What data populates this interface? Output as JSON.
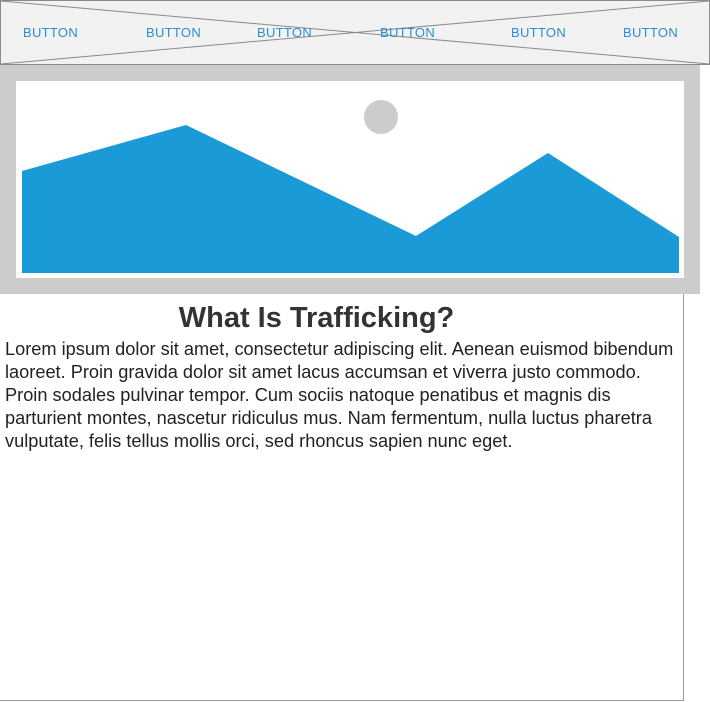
{
  "nav": {
    "buttons": [
      "BUTTON",
      "BUTTON",
      "BUTTON",
      "BUTTON",
      "BUTTON",
      "BUTTON"
    ]
  },
  "hero": {
    "image": "image-placeholder",
    "colors": {
      "frame": "#cccccc",
      "mountain": "#1a9ad6",
      "sun": "#cccccc"
    }
  },
  "content": {
    "title": "What Is Trafficking?",
    "paragraph": "Lorem ipsum dolor sit amet, consectetur adipiscing elit. Aenean euismod bibendum laoreet. Proin gravida dolor sit amet lacus accumsan et viverra justo commodo. Proin sodales pulvinar tempor. Cum sociis natoque penatibus et magnis dis parturient montes, nascetur ridiculus mus. Nam fermentum, nulla luctus pharetra vulputate, felis tellus mollis orci, sed rhoncus sapien nunc eget."
  }
}
